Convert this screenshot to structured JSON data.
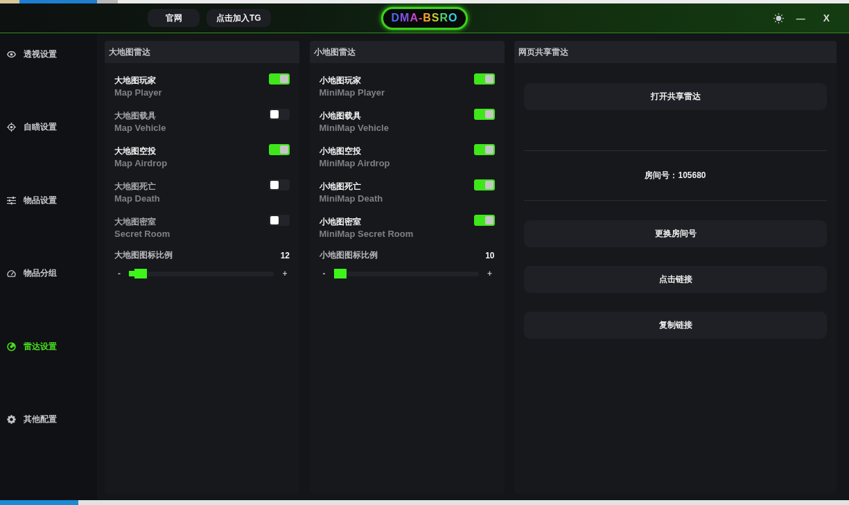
{
  "title_bar": {
    "buttons": [
      {
        "label": "官网"
      },
      {
        "label": "点击加入TG"
      }
    ],
    "logo": "DMA-BSRO",
    "minimize": "—",
    "close": "X"
  },
  "sidebar": {
    "items": [
      {
        "label": "透视设置",
        "selected": false
      },
      {
        "label": "自瞄设置",
        "selected": false
      },
      {
        "label": "物品设置",
        "selected": false
      },
      {
        "label": "物品分组",
        "selected": false
      },
      {
        "label": "雷达设置",
        "selected": true
      },
      {
        "label": "其他配置",
        "selected": false
      }
    ]
  },
  "panels": [
    {
      "kind": "toggles",
      "title": "大地图雷达",
      "toggles": [
        {
          "label": "大地图玩家",
          "sublabel": "Map Player",
          "on": true
        },
        {
          "label": "大地图载具",
          "sublabel": "Map Vehicle",
          "on": false
        },
        {
          "label": "大地图空投",
          "sublabel": "Map Airdrop",
          "on": true
        },
        {
          "label": "大地图死亡",
          "sublabel": "Map Death",
          "on": false
        },
        {
          "label": "大地图密室",
          "sublabel": "Secret Room",
          "on": false
        }
      ],
      "scale": {
        "label": "大地图图标比例",
        "value": "12",
        "minus": "-",
        "plus": "+",
        "level": 0.04
      }
    },
    {
      "kind": "toggles",
      "title": "小地图雷达",
      "toggles": [
        {
          "label": "小地图玩家",
          "sublabel": "MiniMap Player",
          "on": true
        },
        {
          "label": "小地图载具",
          "sublabel": "MiniMap Vehicle",
          "on": true
        },
        {
          "label": "小地图空投",
          "sublabel": "MiniMap Airdrop",
          "on": true
        },
        {
          "label": "小地图死亡",
          "sublabel": "MiniMap Death",
          "on": true
        },
        {
          "label": "小地图密室",
          "sublabel": "MiniMap Secret Room",
          "on": true
        }
      ],
      "scale": {
        "label": "小地图图标比例",
        "value": "10",
        "minus": "-",
        "plus": "+",
        "level": 0
      }
    },
    {
      "kind": "share",
      "title": "网页共享雷达",
      "items": [
        {
          "kind": "button",
          "label": "打开共享雷达"
        },
        {
          "kind": "info",
          "text": "房间号：105680"
        },
        {
          "kind": "button",
          "label": "更换房间号"
        },
        {
          "kind": "button",
          "label": "点击链接"
        },
        {
          "kind": "button",
          "label": "复制链接"
        }
      ]
    }
  ]
}
